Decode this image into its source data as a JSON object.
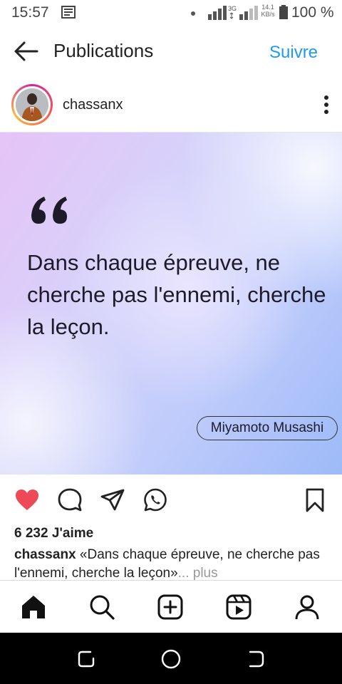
{
  "status_bar": {
    "time": "15:57",
    "network_type": "3G",
    "speed_value": "14.1",
    "speed_unit": "KB/s",
    "battery": "100 %",
    "icons": [
      "news-icon",
      "dot-icon",
      "signal-icon",
      "signal-icon",
      "battery-icon"
    ]
  },
  "header": {
    "title": "Publications",
    "follow_label": "Suivre",
    "back_icon": "arrow-left-icon"
  },
  "post": {
    "username": "chassanx",
    "more_icon": "more-vertical-icon",
    "image": {
      "quote": "Dans chaque épreuve, ne cherche pas l'ennemi, cherche la leçon.",
      "author": "Miyamoto Musashi"
    },
    "likes": "6 232 J'aime",
    "caption_user": "chassanx",
    "caption_text": "«Dans chaque épreuve, ne cherche pas l'ennemi, cherche la leçon»",
    "caption_more": "... plus",
    "liked": true
  },
  "actions": {
    "like_icon": "heart-filled-icon",
    "comment_icon": "comment-icon",
    "share_icon": "send-icon",
    "whatsapp_icon": "whatsapp-icon",
    "save_icon": "bookmark-icon",
    "like_color": "#ed4956"
  },
  "bottom_nav": [
    "home-icon",
    "search-icon",
    "add-post-icon",
    "reels-icon",
    "profile-icon"
  ],
  "android_nav": [
    "recents-icon",
    "home-circle-icon",
    "back-icon"
  ],
  "colors": {
    "accent": "#1e9bf0",
    "like": "#ed4956"
  }
}
